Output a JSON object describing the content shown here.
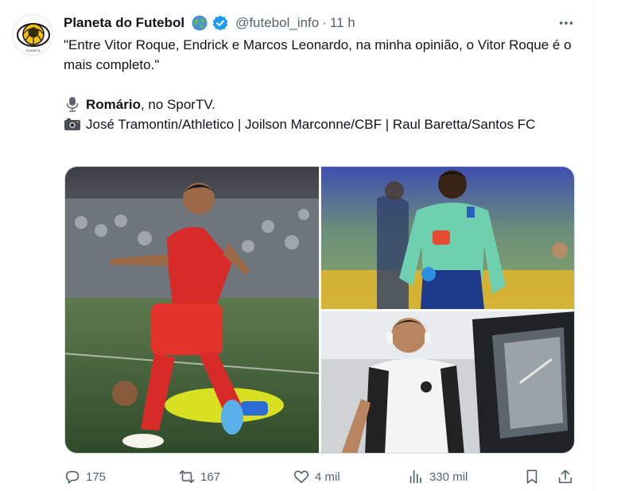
{
  "tweet": {
    "author": {
      "display_name": "Planeta do Futebol",
      "handle": "@futebol_info",
      "separator": "·",
      "time": "11 h",
      "badges": [
        "globe-icon",
        "verified-icon"
      ],
      "avatar": "planeta-do-futebol-logo",
      "verified_color": "#1d9bf0"
    },
    "text": {
      "quote": "\"Entre Vitor Roque, Endrick e Marcos Leonardo, na minha opinião, o Vitor Roque é o mais completo.\"",
      "speaker_name": "Romário",
      "speaker_rest": ", no SporTV.",
      "credits": "José Tramontin/Athletico | Joilson Marconne/CBF | Raul Baretta/Santos FC",
      "speaker_icon": "microphone-icon",
      "credits_icon": "camera-icon"
    },
    "media": [
      {
        "name": "photo-vitor-roque-athletico",
        "alt": "player celebrating in red kit"
      },
      {
        "name": "photo-endrick-cbf",
        "alt": "player in green training top"
      },
      {
        "name": "photo-marcos-leonardo-santos",
        "alt": "player in white Santos shirt with headphones"
      }
    ],
    "actions": {
      "replies": "175",
      "reposts": "167",
      "likes": "4 mil",
      "views": "330 mil"
    },
    "colors": {
      "text": "#0f1419",
      "secondary": "#536471",
      "accent": "#1d9bf0"
    }
  }
}
